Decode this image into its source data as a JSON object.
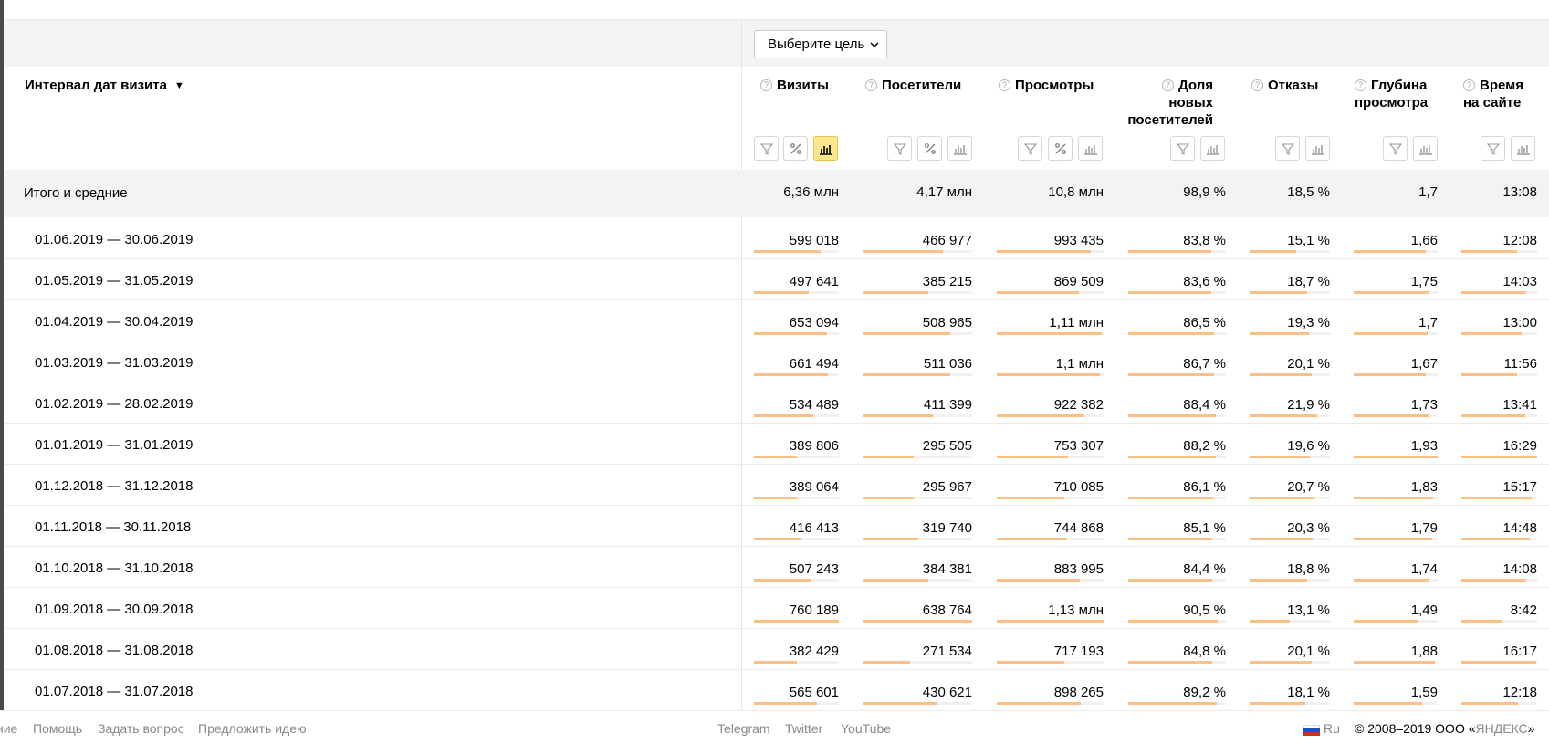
{
  "goal_selector": {
    "label": "Выберите цель"
  },
  "dimension": {
    "title": "Интервал дат визита",
    "sort_arrow": "▼"
  },
  "columns": [
    {
      "key": "visits",
      "label_lines": [
        "Визиты"
      ]
    },
    {
      "key": "visitors",
      "label_lines": [
        "Посетители"
      ]
    },
    {
      "key": "pageviews",
      "label_lines": [
        "Просмотры"
      ]
    },
    {
      "key": "new_share",
      "label_lines": [
        "Доля",
        "новых",
        "посетителей"
      ]
    },
    {
      "key": "bounce",
      "label_lines": [
        "Отказы"
      ]
    },
    {
      "key": "depth",
      "label_lines": [
        "Глубина",
        "просмотра"
      ]
    },
    {
      "key": "time",
      "label_lines": [
        "Время",
        "на сайте"
      ]
    }
  ],
  "totals": {
    "label": "Итого и средние",
    "values": [
      "6,36 млн",
      "4,17 млн",
      "10,8 млн",
      "98,9 %",
      "18,5 %",
      "1,7",
      "13:08"
    ]
  },
  "rows": [
    {
      "date": "01.06.2019 — 30.06.2019",
      "values": [
        "599 018",
        "466 977",
        "993 435",
        "83,8 %",
        "15,1 %",
        "1,66",
        "12:08"
      ],
      "bars": [
        0.79,
        0.73,
        0.88,
        0.85,
        0.58,
        0.86,
        0.74
      ]
    },
    {
      "date": "01.05.2019 — 31.05.2019",
      "values": [
        "497 641",
        "385 215",
        "869 509",
        "83,6 %",
        "18,7 %",
        "1,75",
        "14:03"
      ],
      "bars": [
        0.65,
        0.6,
        0.77,
        0.85,
        0.72,
        0.9,
        0.86
      ]
    },
    {
      "date": "01.04.2019 — 30.04.2019",
      "values": [
        "653 094",
        "508 965",
        "1,11 млн",
        "86,5 %",
        "19,3 %",
        "1,7",
        "13:00"
      ],
      "bars": [
        0.86,
        0.8,
        0.98,
        0.88,
        0.74,
        0.88,
        0.79
      ]
    },
    {
      "date": "01.03.2019 — 31.03.2019",
      "values": [
        "661 494",
        "511 036",
        "1,1 млн",
        "86,7 %",
        "20,1 %",
        "1,67",
        "11:56"
      ],
      "bars": [
        0.87,
        0.8,
        0.97,
        0.88,
        0.77,
        0.86,
        0.73
      ]
    },
    {
      "date": "01.02.2019 — 28.02.2019",
      "values": [
        "534 489",
        "411 399",
        "922 382",
        "88,4 %",
        "21,9 %",
        "1,73",
        "13:41"
      ],
      "bars": [
        0.7,
        0.64,
        0.82,
        0.9,
        0.84,
        0.89,
        0.84
      ]
    },
    {
      "date": "01.01.2019 — 31.01.2019",
      "values": [
        "389 806",
        "295 505",
        "753 307",
        "88,2 %",
        "19,6 %",
        "1,93",
        "16:29"
      ],
      "bars": [
        0.51,
        0.46,
        0.67,
        0.9,
        0.75,
        1.0,
        1.0
      ]
    },
    {
      "date": "01.12.2018 — 31.12.2018",
      "values": [
        "389 064",
        "295 967",
        "710 085",
        "86,1 %",
        "20,7 %",
        "1,83",
        "15:17"
      ],
      "bars": [
        0.51,
        0.46,
        0.63,
        0.87,
        0.79,
        0.95,
        0.93
      ]
    },
    {
      "date": "01.11.2018 — 30.11.2018",
      "values": [
        "416 413",
        "319 740",
        "744 868",
        "85,1 %",
        "20,3 %",
        "1,79",
        "14:48"
      ],
      "bars": [
        0.55,
        0.5,
        0.66,
        0.86,
        0.78,
        0.93,
        0.9
      ]
    },
    {
      "date": "01.10.2018 — 31.10.2018",
      "values": [
        "507 243",
        "384 381",
        "883 995",
        "84,4 %",
        "18,8 %",
        "1,74",
        "14:08"
      ],
      "bars": [
        0.67,
        0.6,
        0.78,
        0.86,
        0.72,
        0.9,
        0.86
      ]
    },
    {
      "date": "01.09.2018 — 30.09.2018",
      "values": [
        "760 189",
        "638 764",
        "1,13 млн",
        "90,5 %",
        "13,1 %",
        "1,49",
        "8:42"
      ],
      "bars": [
        1.0,
        1.0,
        1.0,
        0.92,
        0.5,
        0.77,
        0.53
      ]
    },
    {
      "date": "01.08.2018 — 31.08.2018",
      "values": [
        "382 429",
        "271 534",
        "717 193",
        "84,8 %",
        "20,1 %",
        "1,88",
        "16:17"
      ],
      "bars": [
        0.5,
        0.43,
        0.63,
        0.86,
        0.77,
        0.97,
        0.99
      ]
    },
    {
      "date": "01.07.2018 — 31.07.2018",
      "values": [
        "565 601",
        "430 621",
        "898 265",
        "89,2 %",
        "18,1 %",
        "1,59",
        "12:18"
      ],
      "bars": [
        0.74,
        0.67,
        0.79,
        0.91,
        0.69,
        0.82,
        0.75
      ]
    }
  ],
  "footer": {
    "links": [
      "ние",
      "Помощь",
      "Задать вопрос",
      "Предложить идею",
      "Telegram",
      "Twitter",
      "YouTube"
    ],
    "lang": "Ru",
    "copyright": "© 2008–2019 ООО «",
    "brand": "ЯНДЕКС",
    "copyright_end": "»"
  },
  "colors": {
    "bar": "#fbc086",
    "active_chart_btn": "#fde68d",
    "row_bg_total": "#f4f3f1"
  }
}
